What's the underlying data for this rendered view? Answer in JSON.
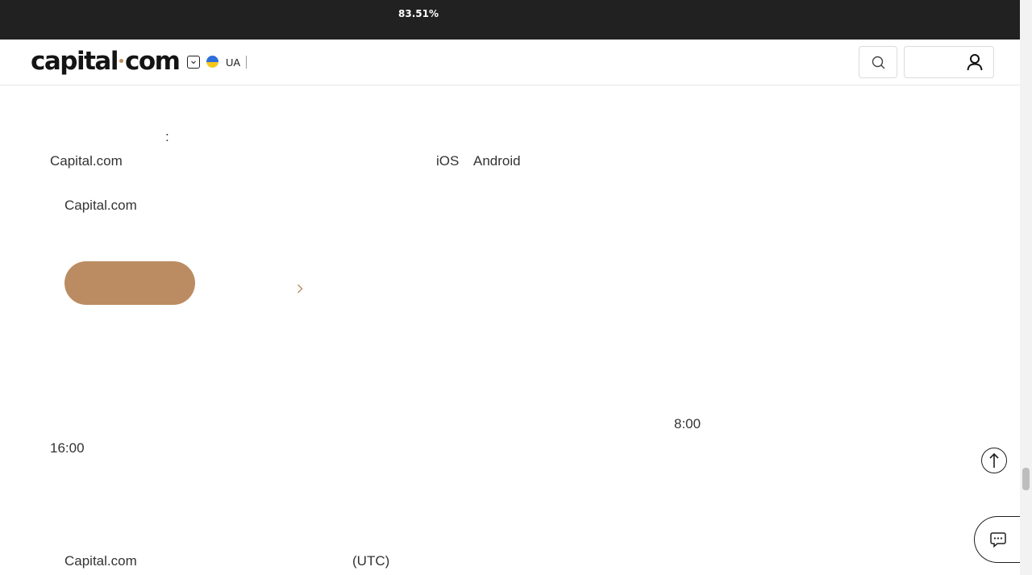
{
  "ticker": {
    "value": "83.51%"
  },
  "header": {
    "logo_left": "capital",
    "logo_right": "com",
    "lang_code": "UA",
    "icons": {
      "lang": "chevron-down-icon",
      "flag": "ukraine-flag-icon",
      "search": "search-icon",
      "account": "user-icon"
    }
  },
  "content": {
    "colon": ":",
    "brand_line1": "Capital.com",
    "platform_ios": "iOS",
    "platform_android": "Android",
    "brand_line2": "Capital.com",
    "time_open": "8:00",
    "time_close": "16:00",
    "brand_line3": "Capital.com",
    "timezone": "(UTC)"
  },
  "floating": {
    "scroll_top_icon": "arrow-up-icon",
    "chat_icon": "chat-bubble-icon"
  },
  "colors": {
    "accent": "#bb8c62",
    "ticker_bg": "#212121",
    "text": "#333333"
  }
}
